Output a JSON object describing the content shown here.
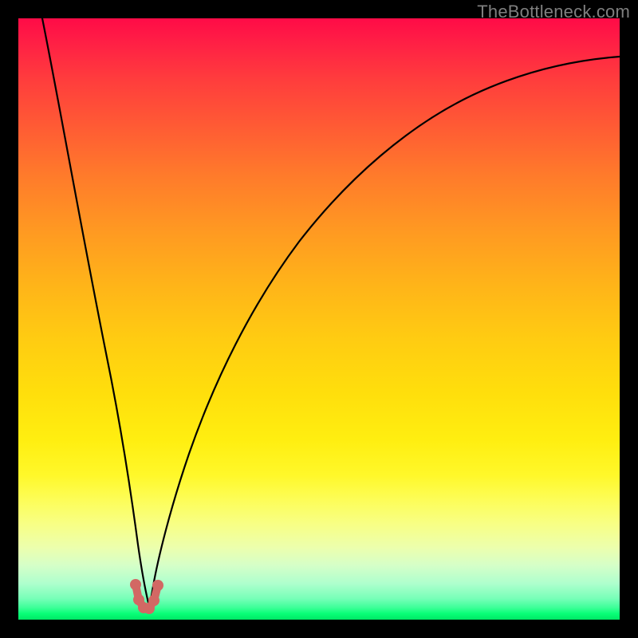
{
  "watermark": "TheBottleneck.com",
  "chart_data": {
    "type": "line",
    "title": "",
    "xlabel": "",
    "ylabel": "",
    "xlim": [
      0,
      100
    ],
    "ylim": [
      0,
      100
    ],
    "grid": false,
    "background_gradient": {
      "direction": "vertical",
      "stops": [
        {
          "pos": 0,
          "color": "#ff0b47"
        },
        {
          "pos": 0.35,
          "color": "#ff9822"
        },
        {
          "pos": 0.62,
          "color": "#ffde0c"
        },
        {
          "pos": 0.84,
          "color": "#f8ff84"
        },
        {
          "pos": 0.96,
          "color": "#77ffb8"
        },
        {
          "pos": 1.0,
          "color": "#00e765"
        }
      ]
    },
    "series": [
      {
        "name": "bottleneck-curve",
        "color": "#000000",
        "x": [
          4,
          6,
          8,
          10,
          12,
          14,
          16,
          17.5,
          19,
          20.2,
          21.2,
          22.2,
          23.5,
          25,
          27,
          30,
          34,
          40,
          48,
          58,
          70,
          84,
          100
        ],
        "y": [
          100,
          87,
          75,
          63,
          52,
          41,
          30,
          21,
          12,
          5,
          2,
          2,
          4,
          9,
          18,
          30,
          42,
          55,
          67,
          77,
          84,
          88,
          90
        ]
      }
    ],
    "markers": {
      "name": "minimum-band",
      "color": "#d26864",
      "points": [
        {
          "x": 19.5,
          "y": 5.8
        },
        {
          "x": 20.1,
          "y": 3.3
        },
        {
          "x": 20.9,
          "y": 2.2
        },
        {
          "x": 21.7,
          "y": 2.3
        },
        {
          "x": 22.5,
          "y": 3.5
        },
        {
          "x": 23.2,
          "y": 5.9
        }
      ]
    },
    "annotations": []
  }
}
